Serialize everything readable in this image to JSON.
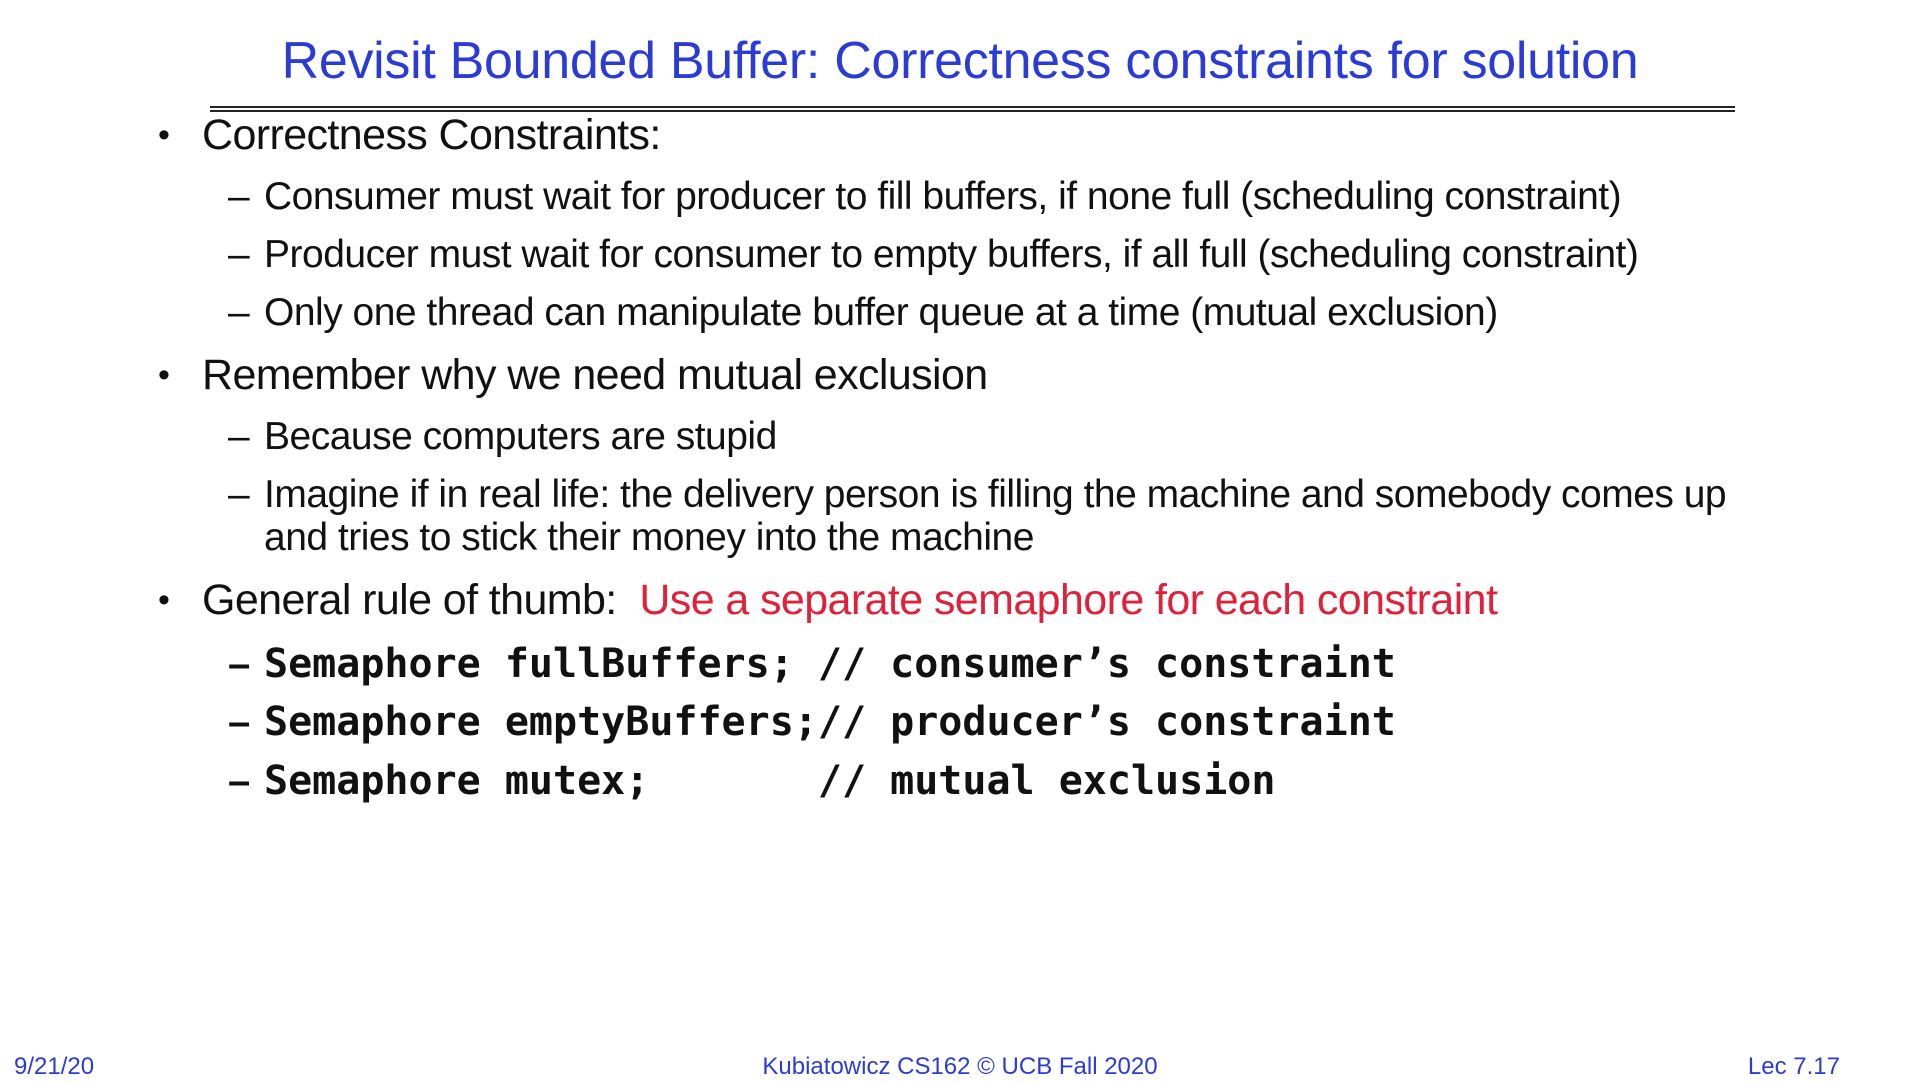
{
  "title": "Revisit Bounded Buffer: Correctness constraints for solution",
  "bullets": [
    {
      "text": "Correctness Constraints:",
      "subs": [
        "Consumer must wait for producer to fill buffers, if none full (scheduling constraint)",
        "Producer must wait for consumer to empty buffers, if all full (scheduling constraint)",
        "Only one thread can manipulate buffer queue at a time (mutual exclusion)"
      ]
    },
    {
      "text": "Remember why we need mutual exclusion",
      "subs": [
        "Because computers are stupid",
        "Imagine if in real life: the delivery person is filling the machine and somebody comes up",
        "and tries to stick their money into the machine"
      ]
    },
    {
      "text": "General rule of thumb:",
      "accent": "Use a separate semaphore for each constraint",
      "code": [
        "Semaphore fullBuffers; // consumer’s constraint",
        "Semaphore emptyBuffers;// producer’s constraint",
        "Semaphore mutex;       // mutual exclusion"
      ]
    }
  ],
  "footer": {
    "date": "9/21/20",
    "center": "Kubiatowicz CS162 © UCB Fall 2020",
    "lecture": "Lec 7.17"
  },
  "colors": {
    "title": "#2b3bd6",
    "accent": "#e0213a",
    "footer": "#2b3bd6"
  }
}
